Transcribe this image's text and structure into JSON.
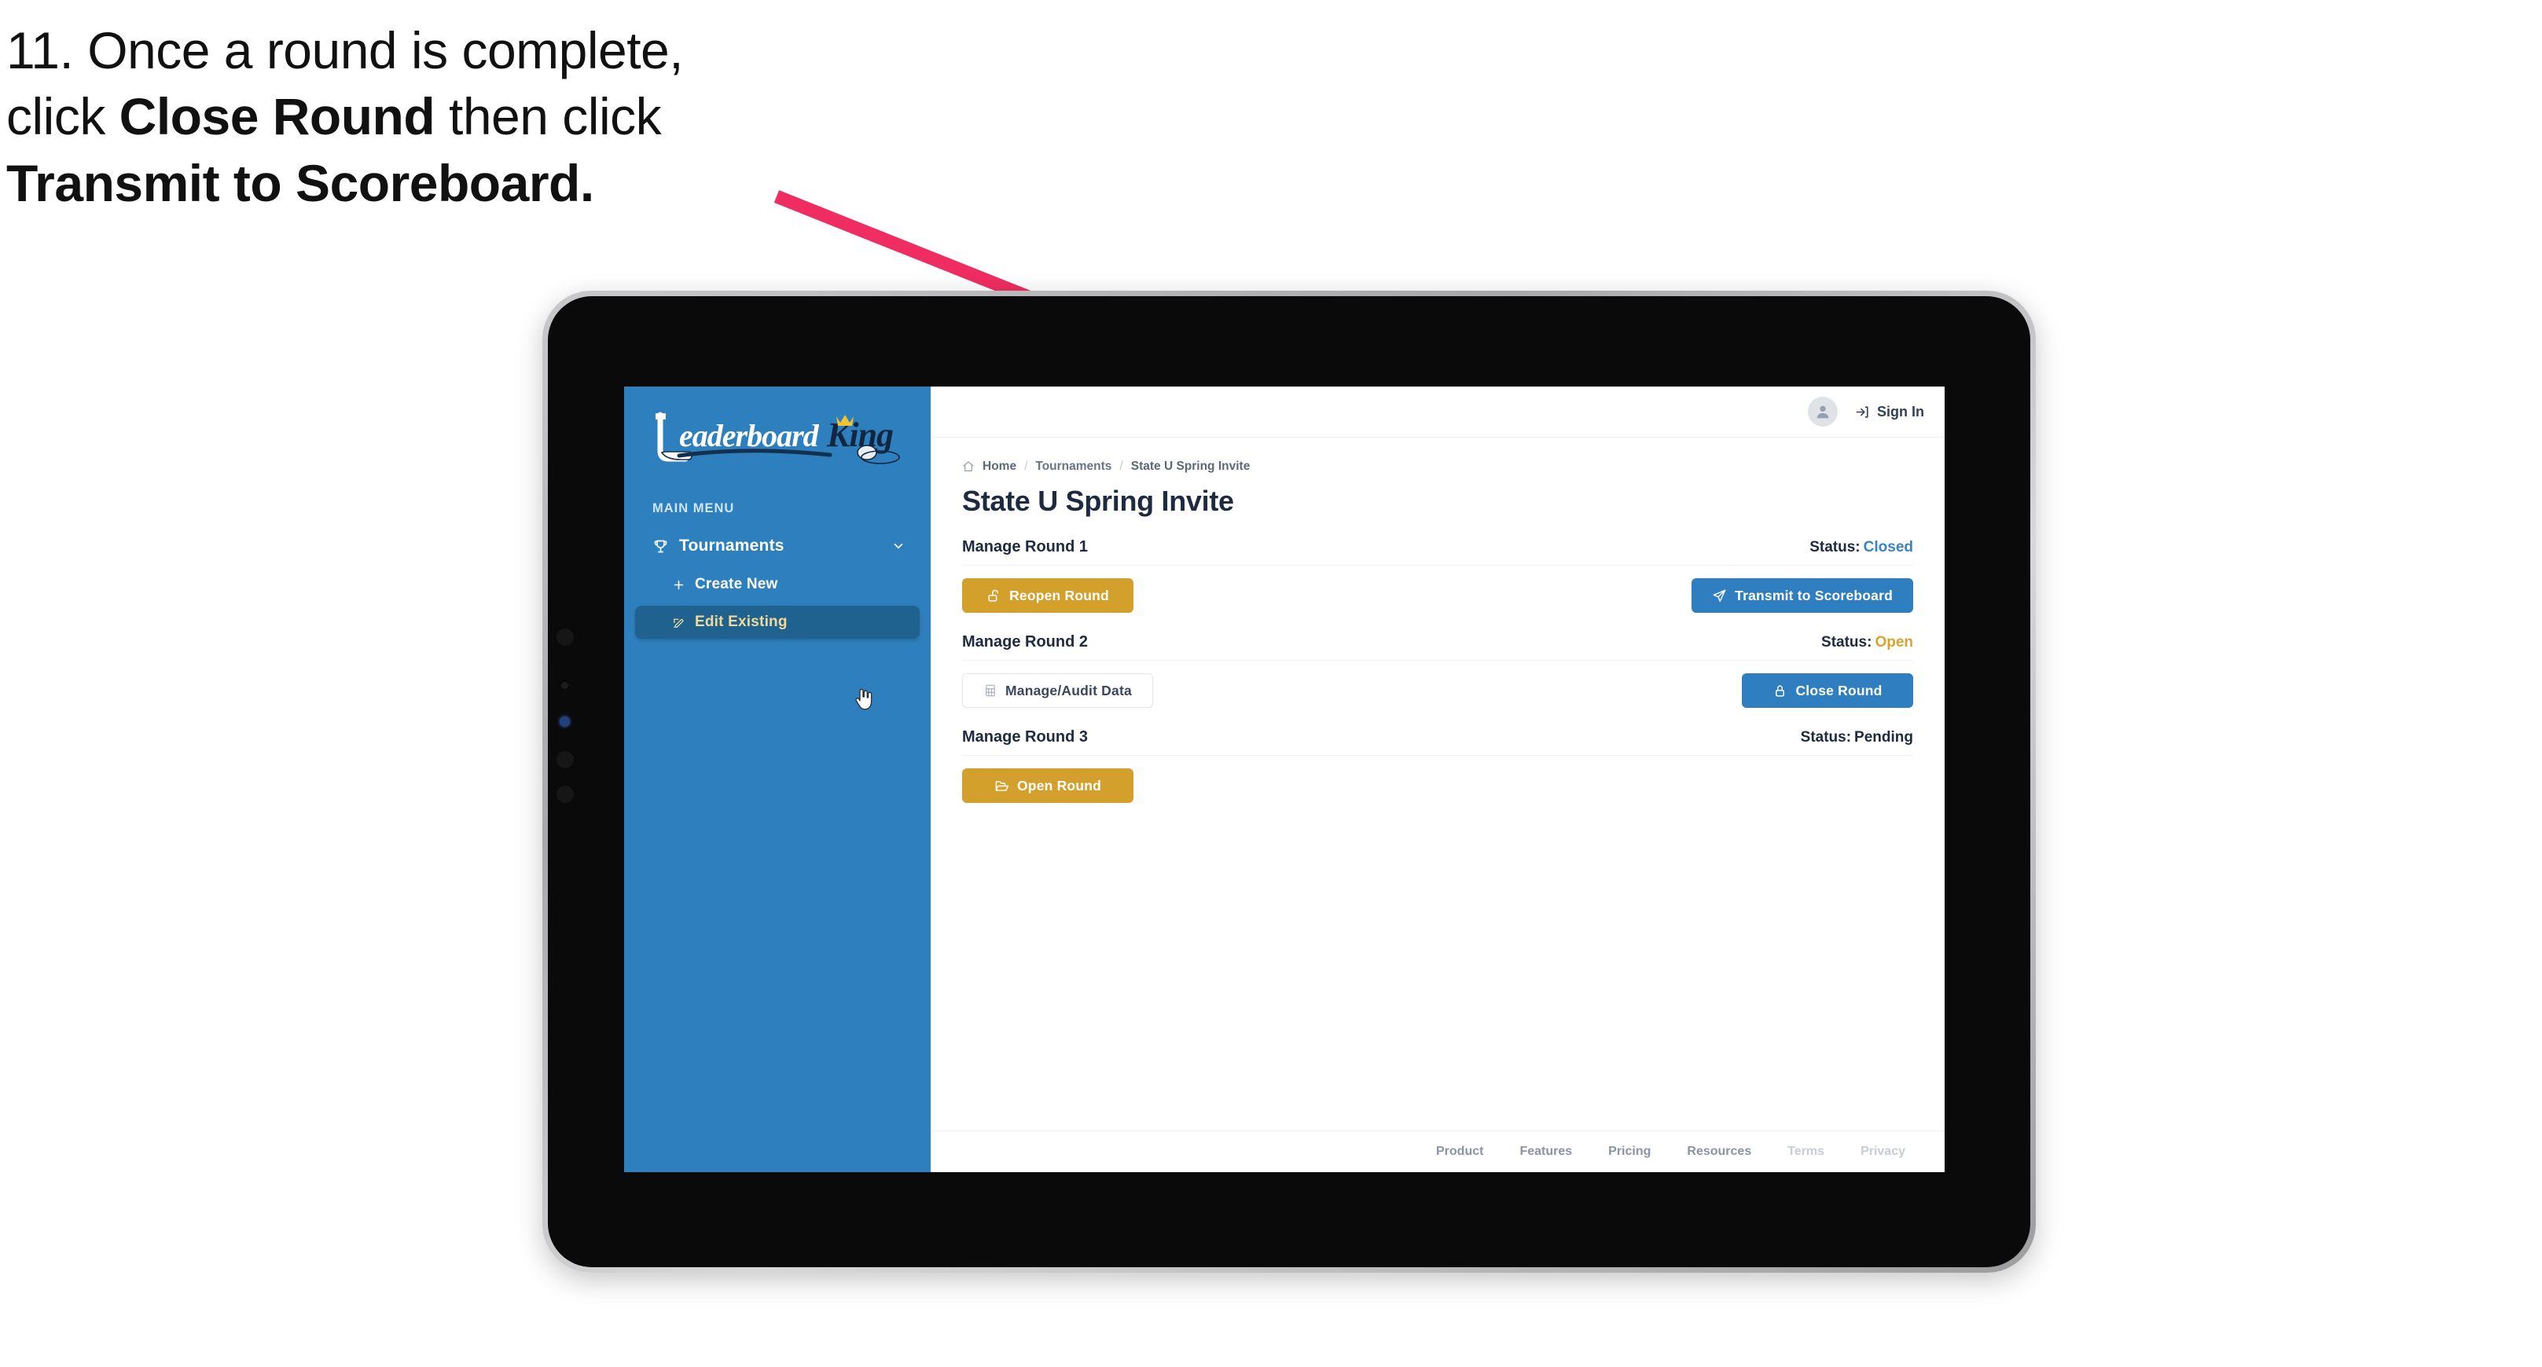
{
  "instruction": {
    "number": "11.",
    "line1_a": "11. Once a round is complete,",
    "line2_a": "click ",
    "line2_bold": "Close Round",
    "line2_b": " then click",
    "line3_bold": "Transmit to Scoreboard."
  },
  "annotation": {
    "arrow_color": "#ef2d62",
    "points_to": "transmit-to-scoreboard-button"
  },
  "sidebar": {
    "logo": {
      "word_one": "Leaderboard",
      "word_two": "King",
      "icon": "golf-club-and-crown"
    },
    "section_label": "MAIN MENU",
    "nav": [
      {
        "label": "Tournaments",
        "icon": "trophy-icon",
        "expanded": true,
        "chevron": "chevron-down-icon"
      }
    ],
    "sub_items": [
      {
        "label": "Create New",
        "icon": "plus-icon",
        "active": false
      },
      {
        "label": "Edit Existing",
        "icon": "edit-pencil-icon",
        "active": true
      }
    ],
    "bg_color": "#2e7fbd",
    "active_bg_color": "#1f628f",
    "active_text_color": "#f0d99b"
  },
  "topbar": {
    "avatar_icon": "user-avatar-icon",
    "signin_icon": "sign-in-arrow-icon",
    "signin_label": "Sign In"
  },
  "breadcrumb": {
    "home_icon": "home-icon",
    "items": [
      "Home",
      "Tournaments",
      "State U Spring Invite"
    ],
    "separator": "/"
  },
  "page": {
    "title": "State U Spring Invite"
  },
  "rounds": [
    {
      "name": "Manage Round 1",
      "status_label": "Status:",
      "status_value": "Closed",
      "status_kind": "closed",
      "left_button": {
        "label": "Reopen Round",
        "icon": "unlock-icon",
        "style": "gold"
      },
      "right_button": {
        "label": "Transmit to Scoreboard",
        "icon": "paper-plane-icon",
        "style": "blue"
      }
    },
    {
      "name": "Manage Round 2",
      "status_label": "Status:",
      "status_value": "Open",
      "status_kind": "open",
      "left_button": {
        "label": "Manage/Audit Data",
        "icon": "table-grid-icon",
        "style": "ghost"
      },
      "right_button": {
        "label": "Close Round",
        "icon": "lock-icon",
        "style": "blue"
      }
    },
    {
      "name": "Manage Round 3",
      "status_label": "Status:",
      "status_value": "Pending",
      "status_kind": "pending",
      "left_button": {
        "label": "Open Round",
        "icon": "open-folder-icon",
        "style": "gold"
      },
      "right_button": null
    }
  ],
  "footer": {
    "links": [
      {
        "label": "Product",
        "muted": false
      },
      {
        "label": "Features",
        "muted": false
      },
      {
        "label": "Pricing",
        "muted": false
      },
      {
        "label": "Resources",
        "muted": false
      },
      {
        "label": "Terms",
        "muted": true
      },
      {
        "label": "Privacy",
        "muted": true
      }
    ]
  },
  "colors": {
    "gold": "#d4a02c",
    "blue": "#2f7ec0",
    "sidebar_blue": "#2e7fbd",
    "status_closed": "#3b82c4",
    "status_open": "#d9a333",
    "arrow_pink": "#ef2d62",
    "title_navy": "#1e2a40"
  },
  "cursor": {
    "type": "pointing-hand-cursor"
  }
}
